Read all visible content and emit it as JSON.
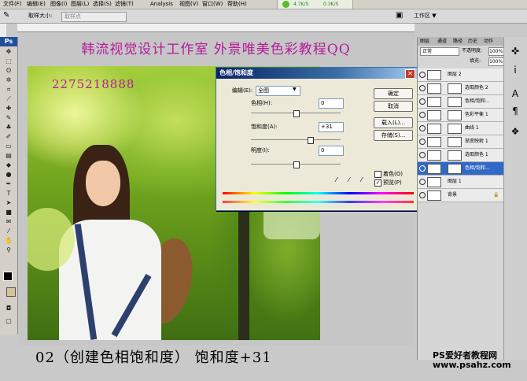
{
  "menu": [
    "文件(F)",
    "编辑(E)",
    "图像(I)",
    "图层(L)",
    "选择(S)",
    "滤镜(T)",
    "Analysis",
    "视图(V)",
    "窗口(W)",
    "帮助(H)"
  ],
  "net_speed": {
    "up": "4.7K/S",
    "down": "0.3K/S"
  },
  "options": {
    "sample_label": "取样大小:",
    "sample_value": "取样点",
    "workspace": "工作区 ▼"
  },
  "title_text": "韩流视觉设计工作室  外景唯美色彩教程QQ",
  "qq_number": "2275218888",
  "caption": "02（创建色相饱和度）  饱和度+31",
  "watermark": {
    "line1": "PS爱好者教程网",
    "line2": "www.psahz.com"
  },
  "dialog": {
    "title": "色相/饱和度",
    "edit_label": "编辑(E):",
    "edit_value": "全图",
    "hue_label": "色相(H):",
    "hue_value": "0",
    "hue_level": 0.5,
    "sat_label": "饱和度(A):",
    "sat_value": "+31",
    "sat_level": 0.655,
    "light_label": "明度(I):",
    "light_value": "0",
    "light_level": 0.5,
    "ok": "确定",
    "cancel": "取消",
    "load": "载入(L)...",
    "save": "存储(S)...",
    "colorize": "着色(O)",
    "preview": "预览(P)",
    "preview_checked": true
  },
  "panel": {
    "tabs": [
      "图层",
      "通道",
      "路径",
      "历史",
      "动作"
    ],
    "blend": "正常",
    "opacity_label": "不透明度:",
    "opacity": "100%",
    "fill_label": "填充:",
    "fill": "100%",
    "layers": [
      {
        "name": "图层 2",
        "selected": false
      },
      {
        "name": "选取颜色 2",
        "selected": false
      },
      {
        "name": "色相/饱和...",
        "selected": false
      },
      {
        "name": "色彩平衡 1",
        "selected": false
      },
      {
        "name": "曲线 1",
        "selected": false
      },
      {
        "name": "渐变映射 1",
        "selected": false
      },
      {
        "name": "选取颜色 1",
        "selected": false
      },
      {
        "name": "色相/饱和...",
        "selected": true
      },
      {
        "name": "图层 1",
        "selected": false
      },
      {
        "name": "背景",
        "selected": false
      }
    ]
  },
  "colors": {
    "accent": "#b51b9b",
    "selection": "#3169c6",
    "dialog_bar": "#0a246a"
  }
}
